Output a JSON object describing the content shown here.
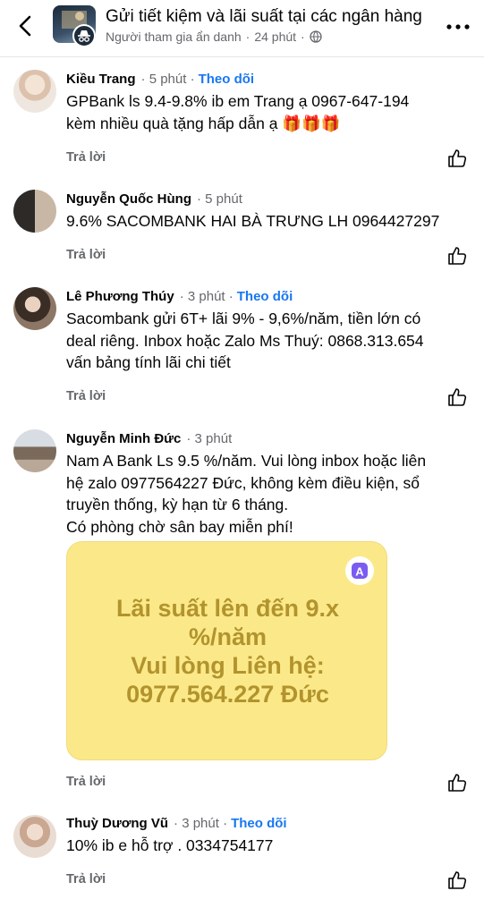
{
  "header": {
    "title": "Gửi tiết kiệm và lãi suất tại các ngân hàng",
    "author": "Người tham gia ẩn danh",
    "time": "24 phút",
    "separator": "·"
  },
  "comments": [
    {
      "name": "Kiều Trang",
      "time": "5 phút",
      "follow": "Theo dõi",
      "lines": [
        "GPBank ls 9.4-9.8% ib em Trang ạ 0967-647-194",
        "kèm nhiều quà tặng hấp dẫn ạ 🎁🎁🎁"
      ],
      "reply": "Trả lời"
    },
    {
      "name": "Nguyễn Quốc Hùng",
      "time": "5 phút",
      "lines": [
        "9.6% SACOMBANK HAI BÀ TRƯNG LH 0964427297"
      ],
      "reply": "Trả lời"
    },
    {
      "name": "Lê Phương Thúy",
      "time": "3 phút",
      "follow": "Theo dõi",
      "lines": [
        "Sacombank gửi 6T+ lãi 9% - 9,6%/năm, tiền lớn có",
        "deal riêng. Inbox hoặc Zalo Ms Thuý: 0868.313.654",
        "vấn bảng tính lãi chi tiết"
      ],
      "reply": "Trả lời"
    },
    {
      "name": "Nguyễn Minh Đức",
      "time": "3 phút",
      "lines": [
        "Nam A Bank Ls 9.5 %/năm. Vui lòng inbox hoặc liên",
        "hệ zalo 0977564227 Đức, không kèm điều kiện, sổ",
        "truyền thống, kỳ hạn từ 6 tháng.",
        "Có phòng chờ sân bay miễn phí!"
      ],
      "reply": "Trả lời",
      "promo": {
        "lines": [
          "Lãi suất lên đến 9.x",
          "%/năm",
          "Vui lòng Liên hệ:",
          "0977.564.227 Đức"
        ],
        "badge": "A"
      }
    },
    {
      "name": "Thuỳ Dương Vũ",
      "time": "3 phút",
      "follow": "Theo dõi",
      "lines": [
        "10% ib e hỗ trợ . 0334754177"
      ],
      "reply": "Trả lời"
    }
  ],
  "colors": {
    "link": "#1877f2",
    "meta": "#65676b",
    "promo_bg": "#fbe989",
    "promo_text": "#b2932e"
  },
  "icons": [
    "back-arrow-icon",
    "more-icon",
    "globe-icon",
    "like-icon",
    "anonymous-icon"
  ]
}
